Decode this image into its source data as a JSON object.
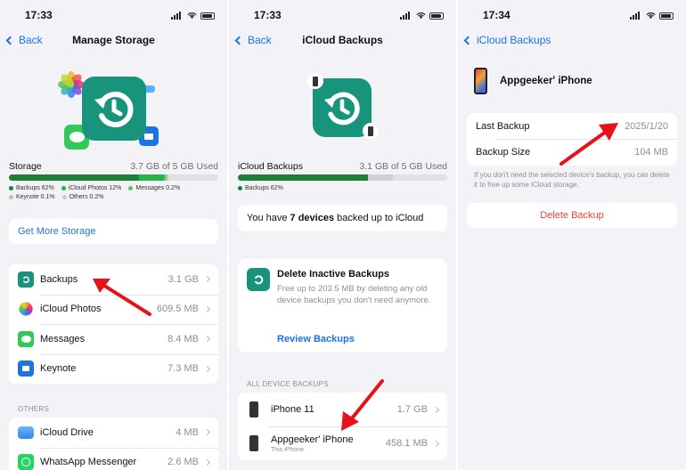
{
  "panel1": {
    "time": "17:33",
    "back": "Back",
    "title": "Manage Storage",
    "storage_label": "Storage",
    "storage_used": "3.7 GB of 5 GB Used",
    "storage_fill": {
      "backups": 0.62,
      "icloud_photos": 0.12,
      "messages": 0.002,
      "keynote": 0.001,
      "others": 0.002
    },
    "legend": [
      {
        "label": "Backups 62%",
        "color": "#1e7f3a"
      },
      {
        "label": "iCloud Photos 12%",
        "color": "#27b34a"
      },
      {
        "label": "Messages 0.2%",
        "color": "#5fbf6e"
      },
      {
        "label": "Keynote 0.1%",
        "color": "#a6d4a9"
      },
      {
        "label": "Others 0.2%",
        "color": "#c9c9cf"
      }
    ],
    "get_more": "Get More Storage",
    "apps": [
      {
        "name": "Backups",
        "size": "3.1 GB"
      },
      {
        "name": "iCloud Photos",
        "size": "609.5 MB"
      },
      {
        "name": "Messages",
        "size": "8.4 MB"
      },
      {
        "name": "Keynote",
        "size": "7.3 MB"
      }
    ],
    "others_label": "OTHERS",
    "others": [
      {
        "name": "iCloud Drive",
        "size": "4 MB"
      },
      {
        "name": "WhatsApp Messenger",
        "size": "2.6 MB"
      }
    ]
  },
  "panel2": {
    "time": "17:33",
    "back": "Back",
    "title": "iCloud Backups",
    "storage_label": "iCloud Backups",
    "storage_used": "3.1 GB of 5 GB Used",
    "storage_fill": 0.62,
    "legend": [
      {
        "label": "Backups 62%",
        "color": "#1e7f3a"
      }
    ],
    "devices_pre": "You have ",
    "devices_bold": "7 devices",
    "devices_post": " backed up to iCloud",
    "inactive_title": "Delete Inactive Backups",
    "inactive_desc": "Free up to 203.5 MB by deleting any old device backups you don't need anymore.",
    "review": "Review Backups",
    "all_label": "ALL DEVICE BACKUPS",
    "devices": [
      {
        "name": "iPhone 11",
        "size": "1.7 GB",
        "sub": ""
      },
      {
        "name": "Appgeeker' iPhone",
        "size": "458.1 MB",
        "sub": "This iPhone"
      }
    ]
  },
  "panel3": {
    "time": "17:34",
    "back": "iCloud Backups",
    "device_name": "Appgeeker' iPhone",
    "last_backup_label": "Last Backup",
    "last_backup_value": "2025/1/20",
    "size_label": "Backup Size",
    "size_value": "104 MB",
    "note": "If you don't need the selected device's backup, you can delete it to free up some iCloud storage.",
    "delete": "Delete Backup"
  },
  "colors": {
    "accent": "#1a73e8",
    "destructive": "#ff3b30",
    "backup_green": "#18947d",
    "arrow": "#e8101a"
  }
}
